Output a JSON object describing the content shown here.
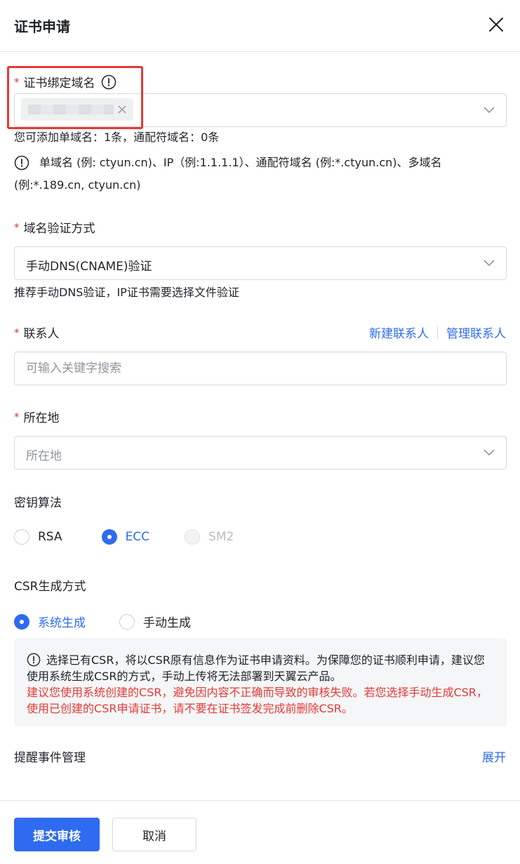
{
  "header": {
    "title": "证书申请"
  },
  "domain": {
    "label": "证书绑定域名",
    "quota": "您可添加单域名：1条，通配符域名：0条",
    "example_line1": "单域名 (例: ctyun.cn)、IP（例:1.1.1.1）、通配符域名 (例:*.ctyun.cn)、多域名",
    "example_line2": "(例:*.189.cn, ctyun.cn)"
  },
  "verify": {
    "label": "域名验证方式",
    "value": "手动DNS(CNAME)验证",
    "hint": "推荐手动DNS验证，IP证书需要选择文件验证"
  },
  "contact": {
    "label": "联系人",
    "new_link": "新建联系人",
    "manage_link": "管理联系人",
    "placeholder": "可输入关键字搜索"
  },
  "location": {
    "label": "所在地",
    "placeholder": "所在地"
  },
  "algorithm": {
    "label": "密钥算法",
    "options": [
      "RSA",
      "ECC",
      "SM2"
    ],
    "selected": "ECC",
    "disabled": "SM2"
  },
  "csr": {
    "label": "CSR生成方式",
    "options": [
      "系统生成",
      "手动生成"
    ],
    "selected": "系统生成",
    "notice_line1": "选择已有CSR，将以CSR原有信息作为证书申请资料。为保障您的证书顺利申请，建议您使用系统生成CSR的方式，手动上传将无法部署到天翼云产品。",
    "notice_line2": "建议您使用系统创建的CSR，避免因内容不正确而导致的审核失败。若您选择手动生成CSR，使用已创建的CSR申请证书，请不要在证书签发完成前删除CSR。"
  },
  "reminder": {
    "label": "提醒事件管理",
    "expand": "展开"
  },
  "footer": {
    "submit": "提交审核",
    "cancel": "取消"
  },
  "colors": {
    "primary": "#2f6bf0",
    "required": "#e53935",
    "highlight": "#e53935"
  }
}
